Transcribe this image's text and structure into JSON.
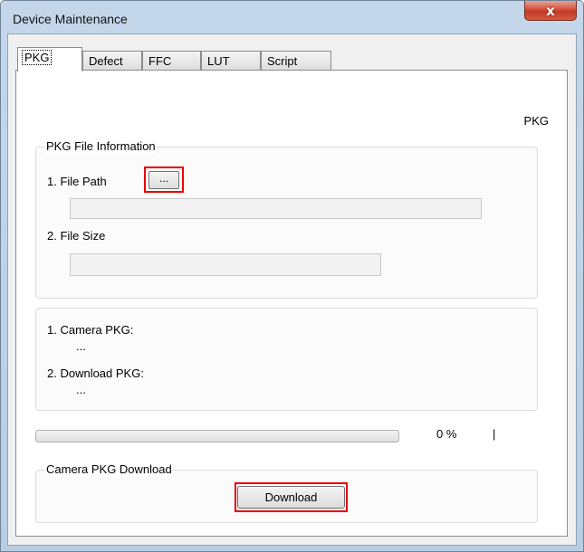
{
  "window": {
    "title": "Device Maintenance",
    "close_glyph": "x"
  },
  "tabs": [
    {
      "label": "PKG",
      "active": true
    },
    {
      "label": "Defect",
      "active": false
    },
    {
      "label": "FFC",
      "active": false
    },
    {
      "label": "LUT",
      "active": false
    },
    {
      "label": "Script",
      "active": false
    }
  ],
  "panel": {
    "heading": "PKG"
  },
  "file_info": {
    "title": "PKG File Information",
    "file_path_label": "1. File Path",
    "browse_label": "...",
    "file_path_value": "",
    "file_size_label": "2. File Size",
    "file_size_value": ""
  },
  "pkg_info": {
    "camera_label": "1. Camera PKG:",
    "camera_value": "...",
    "download_label": "2. Download PKG:",
    "download_value": "..."
  },
  "progress": {
    "fraction": 0.0,
    "text": "0 %",
    "tail": "|"
  },
  "download_group": {
    "title": "Camera PKG Download",
    "button_label": "Download"
  },
  "colors": {
    "highlight": "#e60000",
    "progress_fill": "#06b025"
  }
}
